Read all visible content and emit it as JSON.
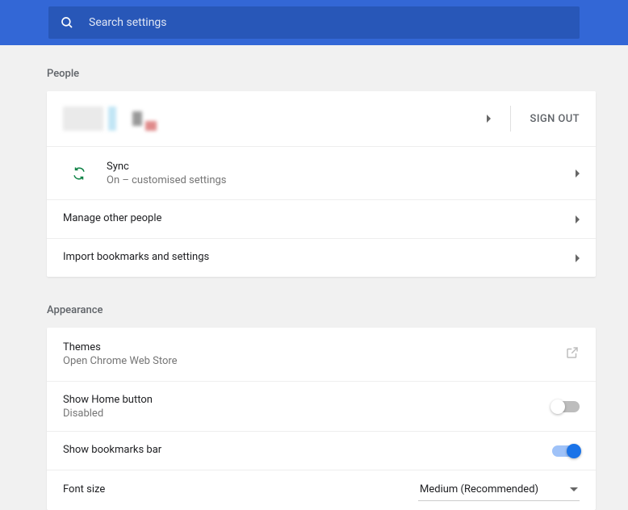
{
  "search": {
    "placeholder": "Search settings"
  },
  "sections": {
    "people": {
      "title": "People",
      "signout": "SIGN OUT",
      "sync": {
        "title": "Sync",
        "subtitle": "On – customised settings"
      },
      "managePeople": "Manage other people",
      "importBookmarks": "Import bookmarks and settings"
    },
    "appearance": {
      "title": "Appearance",
      "themes": {
        "title": "Themes",
        "subtitle": "Open Chrome Web Store"
      },
      "showHome": {
        "title": "Show Home button",
        "subtitle": "Disabled",
        "enabled": false
      },
      "showBookmarksBar": {
        "title": "Show bookmarks bar",
        "enabled": true
      },
      "fontSize": {
        "title": "Font size",
        "value": "Medium (Recommended)"
      }
    }
  }
}
